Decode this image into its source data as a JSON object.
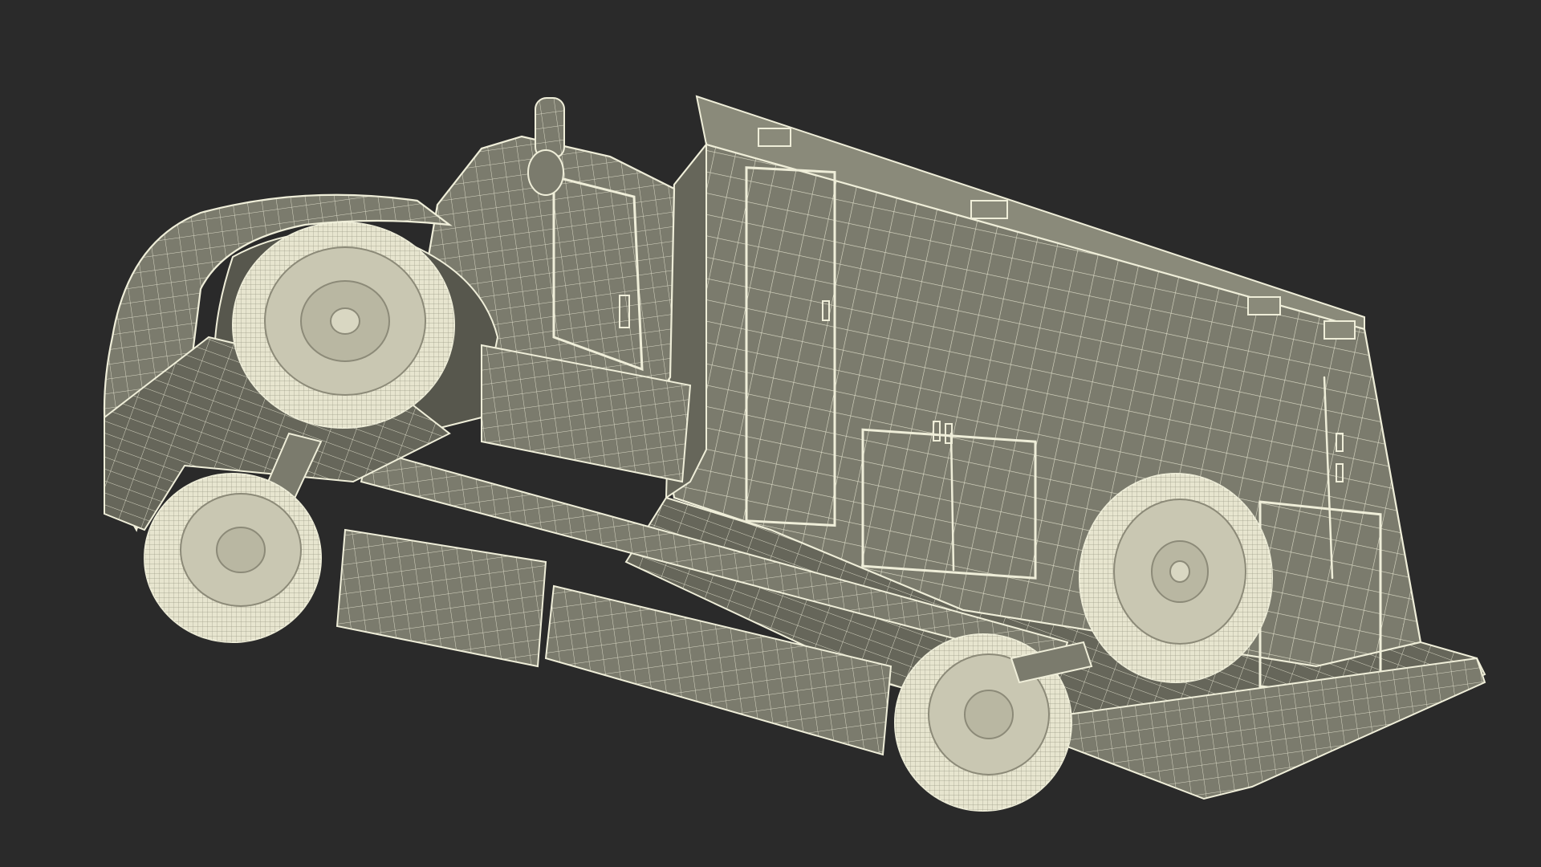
{
  "scene": {
    "description_free": true,
    "colors": {
      "background": "#2a2a2a",
      "surface": "#7b7b6d",
      "surface_shade": "#66665a",
      "surface_dark": "#57574d",
      "wire": "#efeed9",
      "tire": "#e7e5cf",
      "rim": "#c9c7b2"
    },
    "icons": [
      "wireframe-vehicle-model"
    ]
  }
}
